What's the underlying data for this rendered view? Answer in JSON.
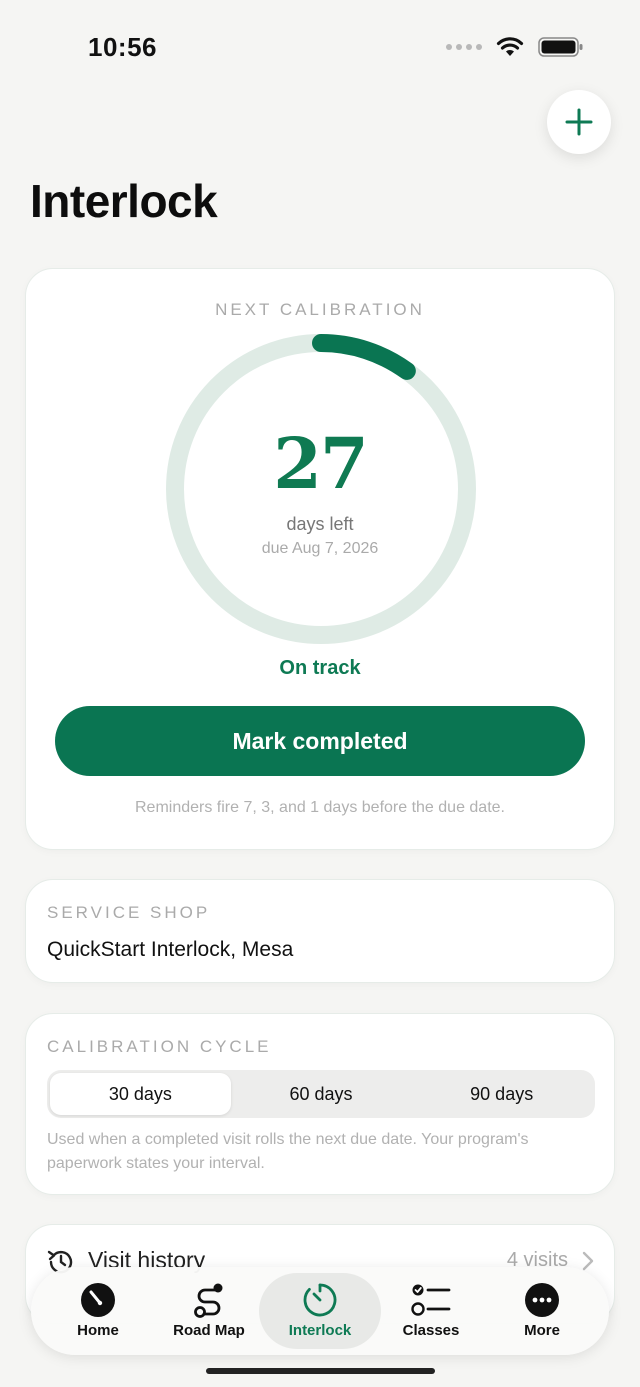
{
  "status_bar": {
    "time": "10:56"
  },
  "page": {
    "title": "Interlock"
  },
  "calibration": {
    "label": "NEXT CALIBRATION",
    "days_left": "27",
    "days_left_caption": "days left",
    "due_date": "due Aug 7, 2026",
    "progress_fraction": 0.1,
    "status": "On track",
    "button_label": "Mark completed",
    "reminder_note": "Reminders fire 7, 3, and 1 days before the due date."
  },
  "service_shop": {
    "label": "SERVICE SHOP",
    "name": "QuickStart Interlock, Mesa"
  },
  "calibration_cycle": {
    "label": "CALIBRATION CYCLE",
    "options": [
      "30 days",
      "60 days",
      "90 days"
    ],
    "selected": "30 days",
    "note": "Used when a completed visit rolls the next due date. Your program's paperwork states your interval."
  },
  "visit_history": {
    "label": "Visit history",
    "count": "4 visits"
  },
  "tab_bar": {
    "items": [
      {
        "label": "Home",
        "icon": "gauge-icon"
      },
      {
        "label": "Road Map",
        "icon": "route-icon"
      },
      {
        "label": "Interlock",
        "icon": "timer-icon"
      },
      {
        "label": "Classes",
        "icon": "checklist-icon"
      },
      {
        "label": "More",
        "icon": "more-icon"
      }
    ],
    "active": "Interlock"
  },
  "colors": {
    "accent": "#0a7552",
    "ring_track": "#dfebe5",
    "background": "#f5f5f3"
  }
}
